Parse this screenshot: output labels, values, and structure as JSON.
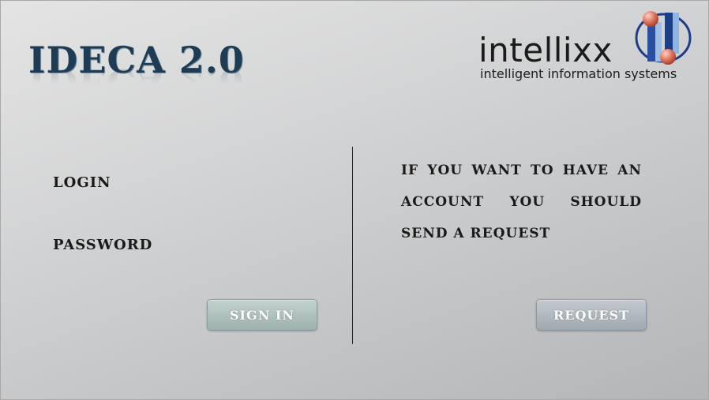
{
  "app": {
    "title": "IDECA 2.0"
  },
  "brand": {
    "name": "intellixx",
    "tagline": "intelligent information systems",
    "logo_icon": "intellixx-mark-icon",
    "colors": {
      "dark_blue": "#1a3f86",
      "light_blue": "#8fb4e6",
      "sphere": "#e2775f",
      "ring": "#1e3c8a"
    }
  },
  "login_form": {
    "login_label": "LOGIN",
    "password_label": "PASSWORD",
    "sign_in_label": "SIGN IN"
  },
  "request_panel": {
    "message": "IF YOU WANT TO HAVE AN ACCOUNT YOU SHOULD SEND A REQUEST",
    "request_label": "REQUEST"
  },
  "theme": {
    "title_color": "#1f3c55",
    "signin_button_color": "#a9bcb8",
    "request_button_color": "#aeb4bb"
  }
}
